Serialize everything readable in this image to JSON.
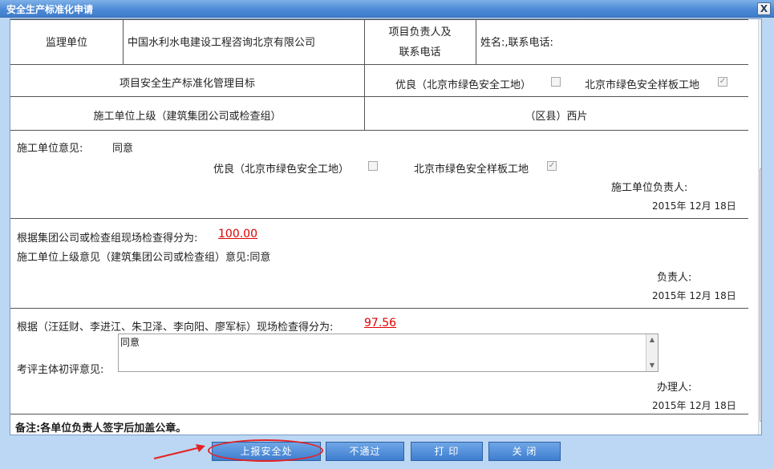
{
  "window": {
    "title": "安全生产标准化申请",
    "close_glyph": "X"
  },
  "row1": {
    "supervisor_label": "监理单位",
    "supervisor_value": "中国水利水电建设工程咨询北京有限公司",
    "manager_label_line1": "项目负责人及",
    "manager_label_line2": "联系电话",
    "manager_value": "姓名:,联系电话:"
  },
  "row2": {
    "goal_label": "项目安全生产标准化管理目标",
    "option_excellent": "优良（北京市绿色安全工地）",
    "option_model": "北京市绿色安全样板工地",
    "excellent_checked": false,
    "model_checked": true
  },
  "row3": {
    "superior_label": "施工单位上级（建筑集团公司或检查组）",
    "district_value": "（区县）西片"
  },
  "section_construction": {
    "opinion_label": "施工单位意见:",
    "opinion_value": "同意",
    "option_excellent": "优良（北京市绿色安全工地）",
    "option_model": "北京市绿色安全样板工地",
    "excellent_checked": false,
    "model_checked": true,
    "responsible_label": "施工单位负责人:",
    "date": "2015年 12月 18日"
  },
  "section_group": {
    "score_label": "根据集团公司或检查组现场检查得分为:",
    "score_value": "100.00",
    "opinion_text": "施工单位上级意见（建筑集团公司或检查组）意见:同意",
    "responsible_label": "负责人:",
    "date": "2015年 12月 18日"
  },
  "section_review": {
    "score_label": "根据（汪廷财、李进江、朱卫泽、李向阳、廖军标）现场检查得分为:",
    "score_value": "97.56",
    "review_label": "考评主体初评意见:",
    "review_text": "同意",
    "handler_label": "办理人:",
    "date": "2015年 12月 18日"
  },
  "note": "备注:各单位负责人签字后加盖公章。",
  "buttons": {
    "submit": "上报安全处",
    "reject": "不通过",
    "print": "打 印",
    "close": "关 闭"
  },
  "checkbox_glyph": "✓",
  "colors": {
    "titlebar": "#4d8ad6",
    "button": "#3e7ecf",
    "score": "#e00000",
    "highlight": "#e52222"
  }
}
